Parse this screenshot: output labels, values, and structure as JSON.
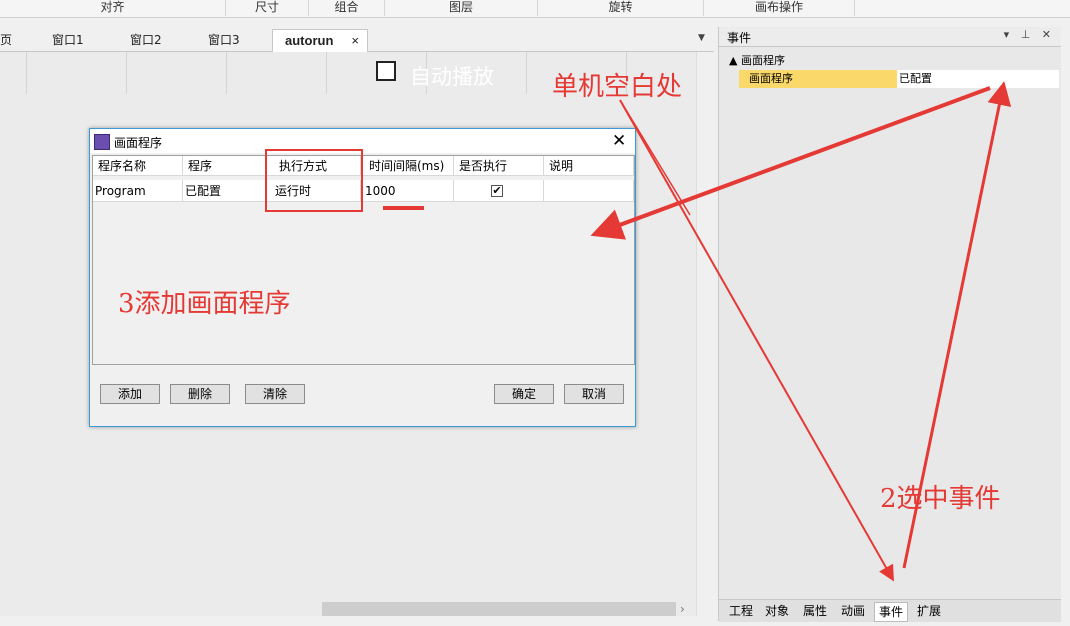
{
  "ribbon": {
    "groups": [
      "对齐",
      "尺寸",
      "组合",
      "图层",
      "旋转",
      "画布操作"
    ]
  },
  "tabs": {
    "partial_left": "页",
    "items": [
      "窗口1",
      "窗口2",
      "窗口3",
      "autorun"
    ],
    "close_glyph": "×",
    "dropdown_glyph": "▼"
  },
  "canvas": {
    "autoplay_label": "自动播放"
  },
  "panel": {
    "title": "事件",
    "header_buttons": "▾ ⊥ ✕",
    "tree_root": "▲ 画面程序",
    "tree_key": "画面程序",
    "tree_value": "已配置",
    "bottom_tabs": [
      "工程",
      "对象",
      "属性",
      "动画",
      "事件",
      "扩展"
    ],
    "active_tab": "事件"
  },
  "dialog": {
    "title": "画面程序",
    "close_glyph": "✕",
    "columns": [
      "程序名称",
      "程序",
      "执行方式",
      "时间间隔(ms)",
      "是否执行",
      "说明"
    ],
    "row": {
      "name": "Program",
      "program": "已配置",
      "mode": "运行时",
      "interval": "1000",
      "enabled": "✔",
      "note": ""
    },
    "buttons": {
      "add": "添加",
      "delete": "删除",
      "clear": "清除",
      "ok": "确定",
      "cancel": "取消"
    }
  },
  "annotations": {
    "step1": "单机空白处",
    "step2": "2选中事件",
    "step3": "3添加画面程序",
    "color": "#e53935"
  }
}
